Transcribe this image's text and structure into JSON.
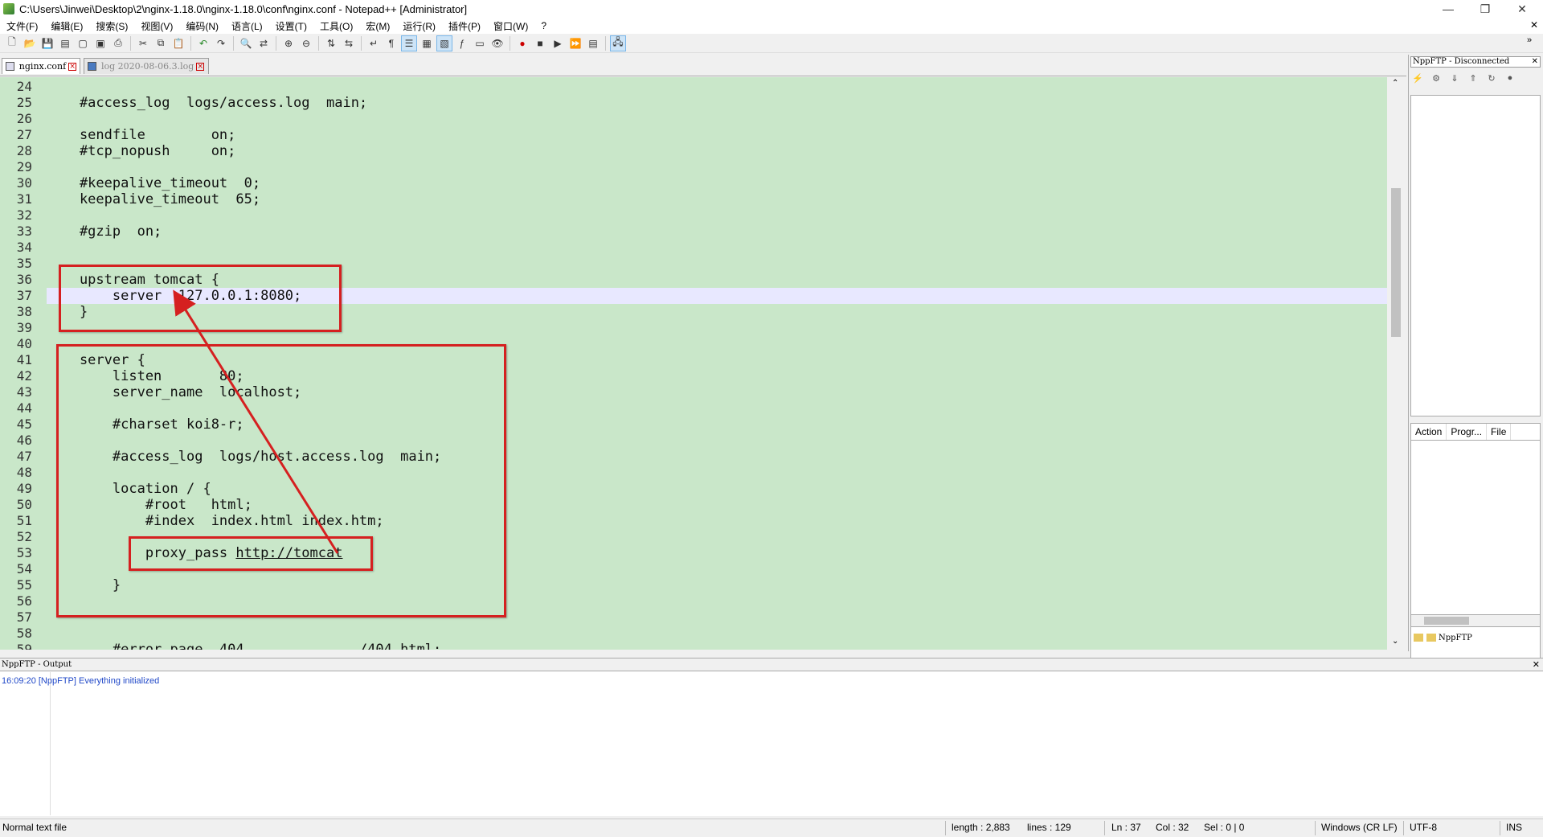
{
  "window": {
    "title": "C:\\Users\\Jinwei\\Desktop\\2\\nginx-1.18.0\\nginx-1.18.0\\conf\\nginx.conf - Notepad++ [Administrator]",
    "minimize": "—",
    "maximize": "❐",
    "close": "✕"
  },
  "menu": [
    "文件(F)",
    "编辑(E)",
    "搜索(S)",
    "视图(V)",
    "编码(N)",
    "语言(L)",
    "设置(T)",
    "工具(O)",
    "宏(M)",
    "运行(R)",
    "插件(P)",
    "窗口(W)",
    "?"
  ],
  "menu_close": "✕",
  "tabs": [
    {
      "label": "nginx.conf",
      "active": true
    },
    {
      "label": "log 2020-08-06.3.log",
      "active": false
    }
  ],
  "editor": {
    "line_numbers": [
      "24",
      "25",
      "26",
      "27",
      "28",
      "29",
      "30",
      "31",
      "32",
      "33",
      "34",
      "35",
      "36",
      "37",
      "38",
      "39",
      "40",
      "41",
      "42",
      "43",
      "44",
      "45",
      "46",
      "47",
      "48",
      "49",
      "50",
      "51",
      "52",
      "53",
      "54",
      "55",
      "56",
      "57",
      "58",
      "59"
    ],
    "lines": [
      "",
      "    #access_log  logs/access.log  main;",
      "",
      "    sendfile        on;",
      "    #tcp_nopush     on;",
      "",
      "    #keepalive_timeout  0;",
      "    keepalive_timeout  65;",
      "",
      "    #gzip  on;",
      "",
      "",
      "    upstream tomcat {",
      "        server  127.0.0.1:8080;",
      "    }",
      "",
      "",
      "    server {",
      "        listen       80;",
      "        server_name  localhost;",
      "",
      "        #charset koi8-r;",
      "",
      "        #access_log  logs/host.access.log  main;",
      "",
      "        location / {",
      "            #root   html;",
      "            #index  index.html index.htm;",
      "",
      "            proxy_pass ",
      "",
      "        }",
      "",
      "",
      "",
      "        #error_page  404              /404.html;"
    ],
    "proxy_url": "http://tomcat",
    "current_line_number": "37",
    "bg_color": "#c9e7c9",
    "annotation_color": "#d52020"
  },
  "ftp_panel": {
    "title": "NppFTP - Disconnected",
    "close": "✕",
    "queue_columns": [
      "Action",
      "Progr...",
      "File"
    ],
    "tab_label": "NppFTP"
  },
  "output": {
    "title": "NppFTP - Output",
    "close": "✕",
    "log": "16:09:20  [NppFTP] Everything initialized"
  },
  "status": {
    "file_type": "Normal text file",
    "length": "length : 2,883",
    "lines": "lines : 129",
    "ln": "Ln : 37",
    "col": "Col : 32",
    "sel": "Sel : 0 | 0",
    "eol": "Windows (CR LF)",
    "encoding": "UTF-8",
    "mode": "INS"
  }
}
